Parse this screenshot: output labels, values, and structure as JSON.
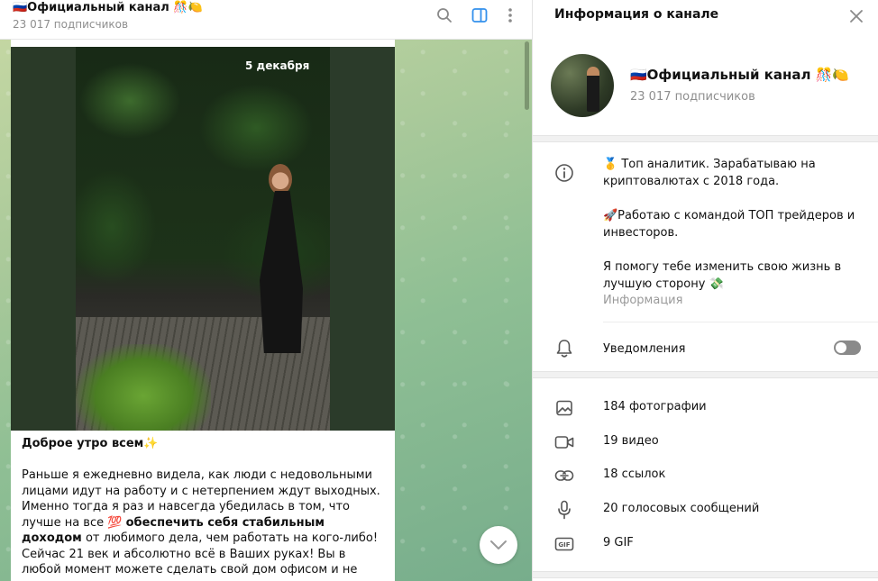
{
  "chat": {
    "title": "🇷🇺Официальный канал 🎊🍋",
    "subscribers": "23 017 подписчиков",
    "date_pill": "5 декабря",
    "post": {
      "greeting": "Доброе утро всем✨",
      "p1_a": "Раньше я ежедневно видела, как люди с недовольными лицами идут на работу и с нетерпением ждут выходных. Именно тогда я раз и навсегда убедилась в том, что лучше на все 💯 ",
      "p1_bold": "обеспечить себя стабильным доходом",
      "p1_b": " от любимого дела, чем работать на кого-либо!",
      "p2": "Сейчас 21 век и абсолютно всё в Ваших руках! Вы в любой момент можете сделать свой дом офисом и не выходя из него"
    }
  },
  "info": {
    "title": "Информация о канале",
    "channel_name": "🇷🇺Официальный канал 🎊🍋",
    "subscribers": "23 017 подписчиков",
    "description": [
      "🥇 Топ аналитик. Зарабатываю на криптовалютах с 2018 года.",
      "🚀Работаю с командой ТОП трейдеров и инвесторов.",
      "Я помогу тебе изменить свою жизнь в лучшую сторону 💸"
    ],
    "description_label": "Информация",
    "notifications_label": "Уведомления",
    "notifications_on": false,
    "media": {
      "photos": "184 фотографии",
      "videos": "19 видео",
      "links": "18 ссылок",
      "voice": "20 голосовых сообщений",
      "gif": "9 GIF"
    }
  },
  "icons": [
    "search-icon",
    "sidebar-toggle-icon",
    "more-vert-icon",
    "close-icon",
    "info-icon",
    "bell-icon",
    "photo-icon",
    "video-icon",
    "link-icon",
    "mic-icon",
    "gif-icon",
    "chevron-down-icon"
  ],
  "colors": {
    "accent": "#3390ec",
    "icon_gray": "#9a9a9a",
    "toggle_off": "#8a8a8a"
  }
}
